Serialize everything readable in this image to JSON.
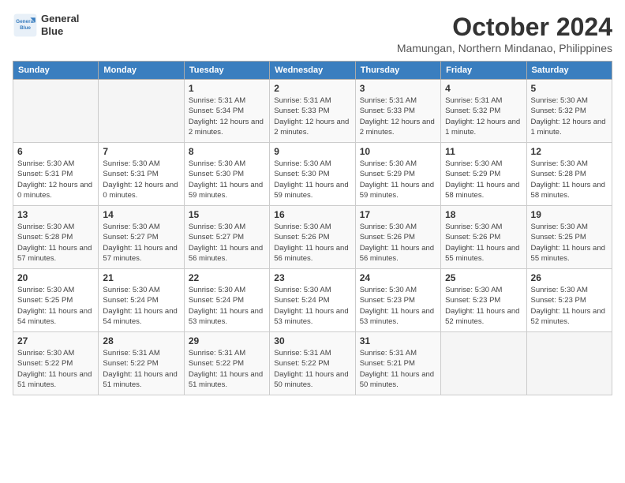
{
  "header": {
    "logo_line1": "General",
    "logo_line2": "Blue",
    "month": "October 2024",
    "location": "Mamungan, Northern Mindanao, Philippines"
  },
  "columns": [
    "Sunday",
    "Monday",
    "Tuesday",
    "Wednesday",
    "Thursday",
    "Friday",
    "Saturday"
  ],
  "weeks": [
    [
      {
        "day": "",
        "info": ""
      },
      {
        "day": "",
        "info": ""
      },
      {
        "day": "1",
        "info": "Sunrise: 5:31 AM\nSunset: 5:34 PM\nDaylight: 12 hours and 2 minutes."
      },
      {
        "day": "2",
        "info": "Sunrise: 5:31 AM\nSunset: 5:33 PM\nDaylight: 12 hours and 2 minutes."
      },
      {
        "day": "3",
        "info": "Sunrise: 5:31 AM\nSunset: 5:33 PM\nDaylight: 12 hours and 2 minutes."
      },
      {
        "day": "4",
        "info": "Sunrise: 5:31 AM\nSunset: 5:32 PM\nDaylight: 12 hours and 1 minute."
      },
      {
        "day": "5",
        "info": "Sunrise: 5:30 AM\nSunset: 5:32 PM\nDaylight: 12 hours and 1 minute."
      }
    ],
    [
      {
        "day": "6",
        "info": "Sunrise: 5:30 AM\nSunset: 5:31 PM\nDaylight: 12 hours and 0 minutes."
      },
      {
        "day": "7",
        "info": "Sunrise: 5:30 AM\nSunset: 5:31 PM\nDaylight: 12 hours and 0 minutes."
      },
      {
        "day": "8",
        "info": "Sunrise: 5:30 AM\nSunset: 5:30 PM\nDaylight: 11 hours and 59 minutes."
      },
      {
        "day": "9",
        "info": "Sunrise: 5:30 AM\nSunset: 5:30 PM\nDaylight: 11 hours and 59 minutes."
      },
      {
        "day": "10",
        "info": "Sunrise: 5:30 AM\nSunset: 5:29 PM\nDaylight: 11 hours and 59 minutes."
      },
      {
        "day": "11",
        "info": "Sunrise: 5:30 AM\nSunset: 5:29 PM\nDaylight: 11 hours and 58 minutes."
      },
      {
        "day": "12",
        "info": "Sunrise: 5:30 AM\nSunset: 5:28 PM\nDaylight: 11 hours and 58 minutes."
      }
    ],
    [
      {
        "day": "13",
        "info": "Sunrise: 5:30 AM\nSunset: 5:28 PM\nDaylight: 11 hours and 57 minutes."
      },
      {
        "day": "14",
        "info": "Sunrise: 5:30 AM\nSunset: 5:27 PM\nDaylight: 11 hours and 57 minutes."
      },
      {
        "day": "15",
        "info": "Sunrise: 5:30 AM\nSunset: 5:27 PM\nDaylight: 11 hours and 56 minutes."
      },
      {
        "day": "16",
        "info": "Sunrise: 5:30 AM\nSunset: 5:26 PM\nDaylight: 11 hours and 56 minutes."
      },
      {
        "day": "17",
        "info": "Sunrise: 5:30 AM\nSunset: 5:26 PM\nDaylight: 11 hours and 56 minutes."
      },
      {
        "day": "18",
        "info": "Sunrise: 5:30 AM\nSunset: 5:26 PM\nDaylight: 11 hours and 55 minutes."
      },
      {
        "day": "19",
        "info": "Sunrise: 5:30 AM\nSunset: 5:25 PM\nDaylight: 11 hours and 55 minutes."
      }
    ],
    [
      {
        "day": "20",
        "info": "Sunrise: 5:30 AM\nSunset: 5:25 PM\nDaylight: 11 hours and 54 minutes."
      },
      {
        "day": "21",
        "info": "Sunrise: 5:30 AM\nSunset: 5:24 PM\nDaylight: 11 hours and 54 minutes."
      },
      {
        "day": "22",
        "info": "Sunrise: 5:30 AM\nSunset: 5:24 PM\nDaylight: 11 hours and 53 minutes."
      },
      {
        "day": "23",
        "info": "Sunrise: 5:30 AM\nSunset: 5:24 PM\nDaylight: 11 hours and 53 minutes."
      },
      {
        "day": "24",
        "info": "Sunrise: 5:30 AM\nSunset: 5:23 PM\nDaylight: 11 hours and 53 minutes."
      },
      {
        "day": "25",
        "info": "Sunrise: 5:30 AM\nSunset: 5:23 PM\nDaylight: 11 hours and 52 minutes."
      },
      {
        "day": "26",
        "info": "Sunrise: 5:30 AM\nSunset: 5:23 PM\nDaylight: 11 hours and 52 minutes."
      }
    ],
    [
      {
        "day": "27",
        "info": "Sunrise: 5:30 AM\nSunset: 5:22 PM\nDaylight: 11 hours and 51 minutes."
      },
      {
        "day": "28",
        "info": "Sunrise: 5:31 AM\nSunset: 5:22 PM\nDaylight: 11 hours and 51 minutes."
      },
      {
        "day": "29",
        "info": "Sunrise: 5:31 AM\nSunset: 5:22 PM\nDaylight: 11 hours and 51 minutes."
      },
      {
        "day": "30",
        "info": "Sunrise: 5:31 AM\nSunset: 5:22 PM\nDaylight: 11 hours and 50 minutes."
      },
      {
        "day": "31",
        "info": "Sunrise: 5:31 AM\nSunset: 5:21 PM\nDaylight: 11 hours and 50 minutes."
      },
      {
        "day": "",
        "info": ""
      },
      {
        "day": "",
        "info": ""
      }
    ]
  ]
}
